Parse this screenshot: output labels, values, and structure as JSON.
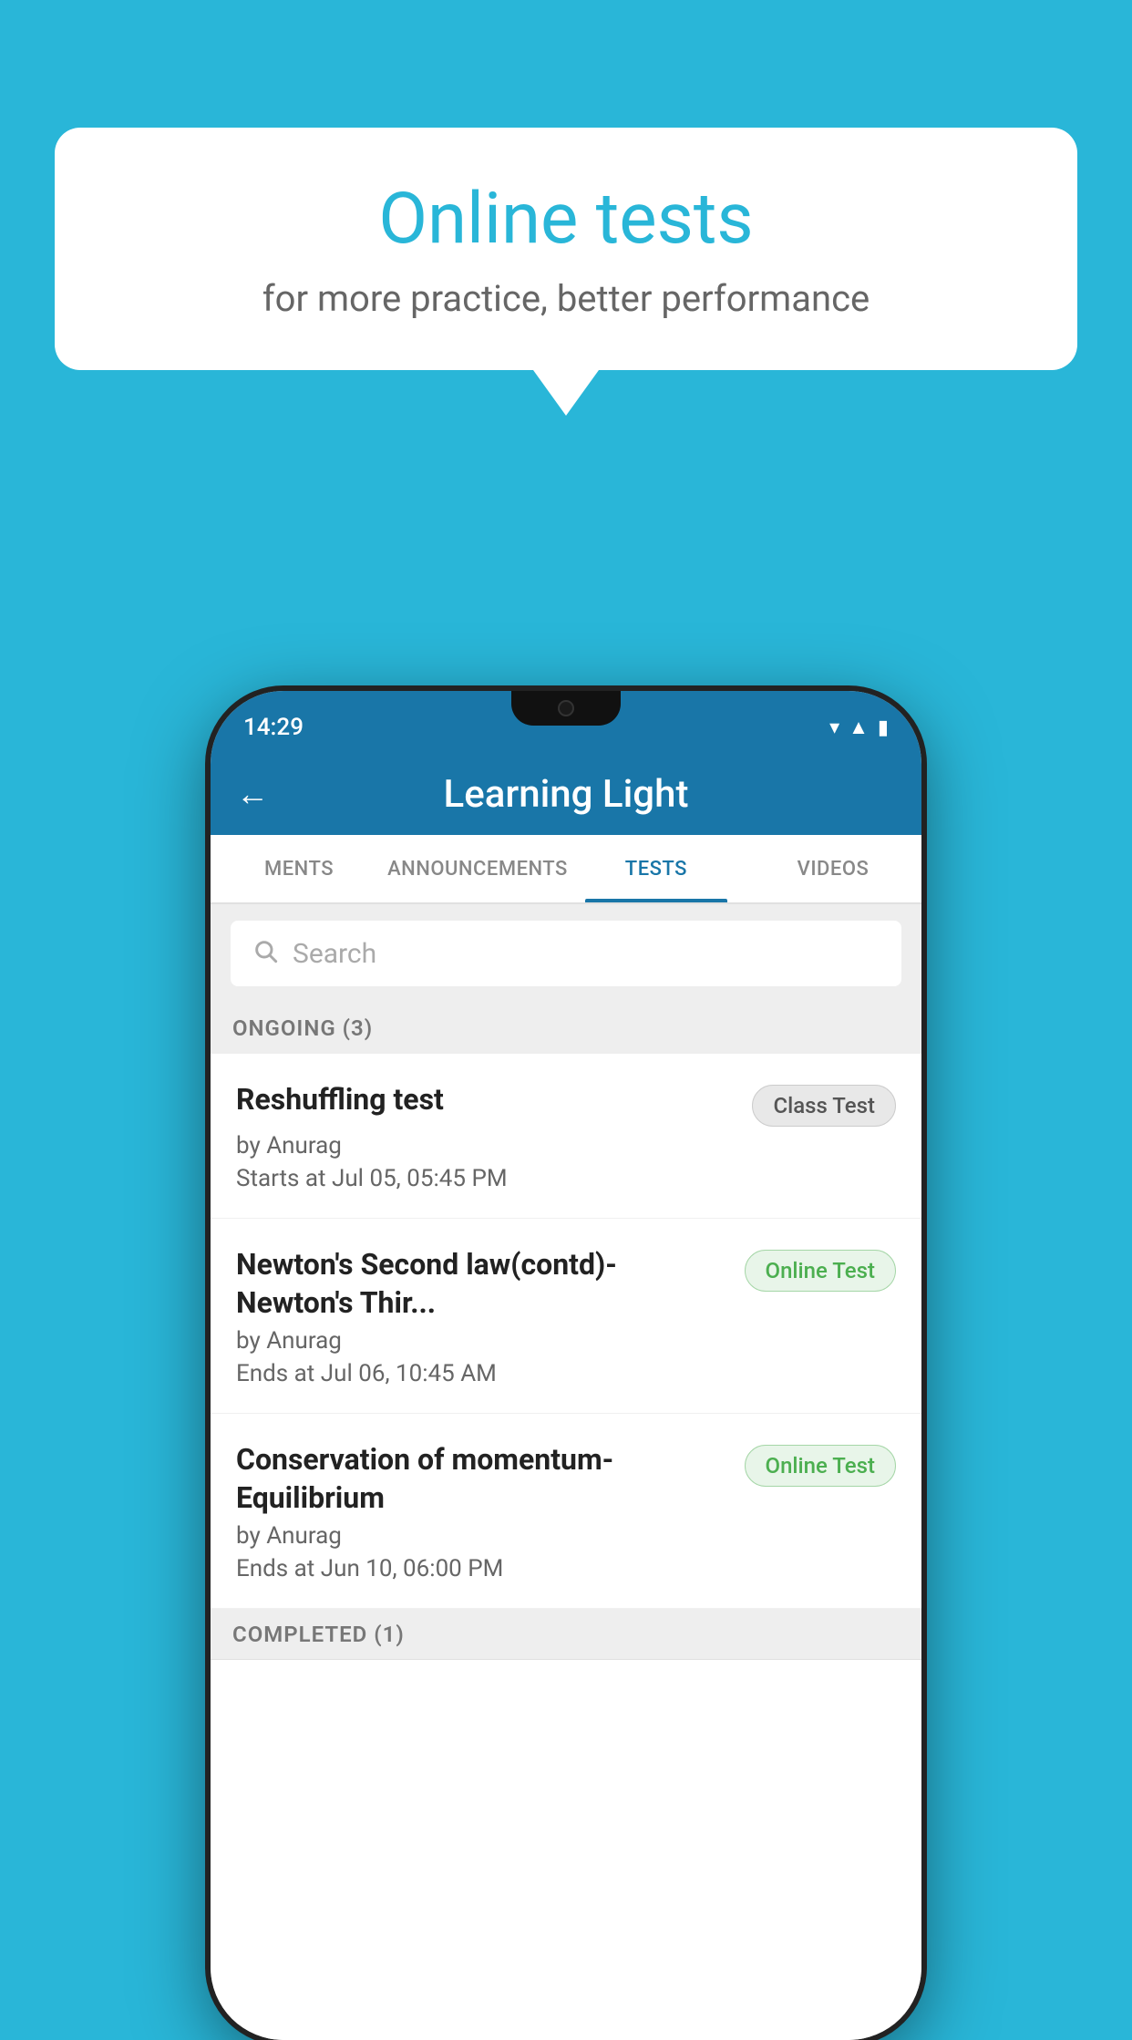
{
  "background": {
    "color": "#29b6d8"
  },
  "speech_bubble": {
    "title": "Online tests",
    "subtitle": "for more practice, better performance"
  },
  "status_bar": {
    "time": "14:29",
    "icons": [
      "wifi",
      "signal",
      "battery"
    ]
  },
  "app_bar": {
    "title": "Learning Light",
    "back_label": "←"
  },
  "tabs": [
    {
      "label": "MENTS",
      "active": false
    },
    {
      "label": "ANNOUNCEMENTS",
      "active": false
    },
    {
      "label": "TESTS",
      "active": true
    },
    {
      "label": "VIDEOS",
      "active": false
    }
  ],
  "search": {
    "placeholder": "Search"
  },
  "ongoing_section": {
    "label": "ONGOING (3)"
  },
  "tests": [
    {
      "title": "Reshuffling test",
      "badge": "Class Test",
      "badge_type": "class",
      "author": "by Anurag",
      "date": "Starts at  Jul 05, 05:45 PM"
    },
    {
      "title": "Newton's Second law(contd)-Newton's Thir...",
      "badge": "Online Test",
      "badge_type": "online",
      "author": "by Anurag",
      "date": "Ends at  Jul 06, 10:45 AM"
    },
    {
      "title": "Conservation of momentum-Equilibrium",
      "badge": "Online Test",
      "badge_type": "online",
      "author": "by Anurag",
      "date": "Ends at  Jun 10, 06:00 PM"
    }
  ],
  "completed_section": {
    "label": "COMPLETED (1)"
  }
}
